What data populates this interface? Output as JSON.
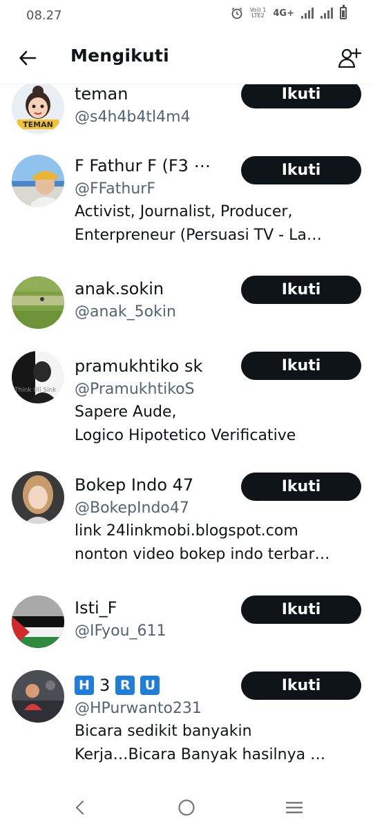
{
  "status_bar": {
    "time": "08.27",
    "lte_top": "Vo)) 1",
    "lte_bottom": "LTE2",
    "network": "4G+"
  },
  "header": {
    "title": "Mengikuti"
  },
  "follow_label": "Ikuti",
  "users": [
    {
      "name": "teman",
      "handle": "@s4h4b4tl4m4",
      "bio": [],
      "avatar_text": "TEMAN"
    },
    {
      "name": "F Fathur F (F3 ⋯",
      "handle": "@FFathurF",
      "bio": [
        "Activist, Journalist, Producer,",
        "Enterpreneur (Persuasi TV - La…"
      ]
    },
    {
      "name": "anak.sokin",
      "handle": "@anak_5okin",
      "bio": []
    },
    {
      "name": "pramukhtiko sk",
      "handle": "@PramukhtikoS",
      "bio": [
        "Sapere Aude,",
        "Logico Hipotetico Verificative"
      ],
      "avatar_text": "Think till Sink"
    },
    {
      "name": "Bokep Indo 47",
      "handle": "@BokepIndo47",
      "bio": [
        "link 24linkmobi.blogspot.com",
        "nonton video bokep indo terbar…"
      ]
    },
    {
      "name": "Isti_F",
      "handle": "@IFyou_611",
      "bio": []
    },
    {
      "name_parts": [
        "H",
        "3",
        "R",
        "U"
      ],
      "handle": "@HPurwanto231",
      "bio": [
        "Bicara sedikit banyakin",
        "Kerja…Bicara Banyak hasilnya …"
      ]
    }
  ],
  "icons": {
    "back": "back-arrow-icon",
    "add_user": "add-user-icon",
    "nav": [
      "nav-back-icon",
      "nav-home-icon",
      "nav-recents-icon"
    ]
  },
  "colors": {
    "button_bg": "#0f1419",
    "handle": "#536471",
    "badge": "#1f7fd6"
  }
}
